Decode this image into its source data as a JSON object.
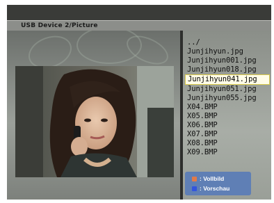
{
  "header": {
    "path": "USB Device 2/Picture"
  },
  "files": [
    {
      "name": "../"
    },
    {
      "name": "Junjihyun.jpg"
    },
    {
      "name": "Junjihyun001.jpg"
    },
    {
      "name": "Junjihyun018.jpg"
    },
    {
      "name": "Junjihyun041.jpg"
    },
    {
      "name": "Junjihyun051.jpg"
    },
    {
      "name": "Junjihyun055.jpg"
    },
    {
      "name": "X04.BMP"
    },
    {
      "name": "X05.BMP"
    },
    {
      "name": "X06.BMP"
    },
    {
      "name": "X07.BMP"
    },
    {
      "name": "X08.BMP"
    },
    {
      "name": "X09.BMP"
    }
  ],
  "selected_file": "Junjihyun041.jpg",
  "legend": {
    "fullscreen": {
      "label": ": Vollbild",
      "color": "#e07a4a"
    },
    "preview": {
      "label": ": Vorschau",
      "color": "#3355dd"
    }
  },
  "preview_image": {
    "icon": "photo-thumbnail"
  }
}
